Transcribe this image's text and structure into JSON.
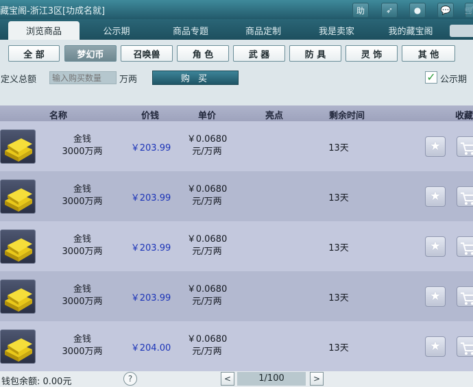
{
  "window": {
    "title": "藏宝阁-浙江3区[功成名就]"
  },
  "titlebar_buttons": [
    {
      "icon": "help-char",
      "label": "助"
    },
    {
      "icon": "share-arrow-icon",
      "label": "➶"
    },
    {
      "icon": "stop-icon",
      "label": "●"
    },
    {
      "icon": "chat-bubble-icon",
      "label": "💬"
    },
    {
      "icon": "cart-icon",
      "label": "🛒"
    }
  ],
  "tabs": [
    {
      "label": "浏览商品",
      "active": true
    },
    {
      "label": "公示期"
    },
    {
      "label": "商品专题"
    },
    {
      "label": "商品定制"
    },
    {
      "label": "我是卖家"
    },
    {
      "label": "我的藏宝阁"
    }
  ],
  "filters": [
    {
      "label": "全 部"
    },
    {
      "label": "梦幻币",
      "active": true
    },
    {
      "label": "召唤兽"
    },
    {
      "label": "角 色"
    },
    {
      "label": "武 器"
    },
    {
      "label": "防 具"
    },
    {
      "label": "灵 饰"
    },
    {
      "label": "其 他"
    }
  ],
  "buy": {
    "label": "自定义总额",
    "placeholder": "输入购买数量",
    "unit": "万两",
    "button": "购 买",
    "public_period_label": "公示期",
    "public_period_checked": true
  },
  "table": {
    "columns": [
      "名称",
      "价钱",
      "单价",
      "亮点",
      "剩余时间",
      "收藏"
    ],
    "rows": [
      {
        "name": "金钱",
        "amount": "3000万两",
        "price": "￥203.99",
        "unit_price": "￥0.0680",
        "unit_suffix": "元/万两",
        "highlight": "",
        "remaining": "13天"
      },
      {
        "name": "金钱",
        "amount": "3000万两",
        "price": "￥203.99",
        "unit_price": "￥0.0680",
        "unit_suffix": "元/万两",
        "highlight": "",
        "remaining": "13天"
      },
      {
        "name": "金钱",
        "amount": "3000万两",
        "price": "￥203.99",
        "unit_price": "￥0.0680",
        "unit_suffix": "元/万两",
        "highlight": "",
        "remaining": "13天"
      },
      {
        "name": "金钱",
        "amount": "3000万两",
        "price": "￥203.99",
        "unit_price": "￥0.0680",
        "unit_suffix": "元/万两",
        "highlight": "",
        "remaining": "13天"
      },
      {
        "name": "金钱",
        "amount": "3000万两",
        "price": "￥204.00",
        "unit_price": "￥0.0680",
        "unit_suffix": "元/万两",
        "highlight": "",
        "remaining": "13天"
      }
    ]
  },
  "footer": {
    "wallet": "钱包余额: 0.00元",
    "help": "?",
    "prev": "<",
    "page": "1/100",
    "next": ">"
  },
  "colors": {
    "header_bg": "#2c6b7c",
    "price_blue": "#1c34b8",
    "row_even": "#c3c8dd",
    "row_odd": "#b3b9d0",
    "public_check_green": "#2e9c3a"
  }
}
